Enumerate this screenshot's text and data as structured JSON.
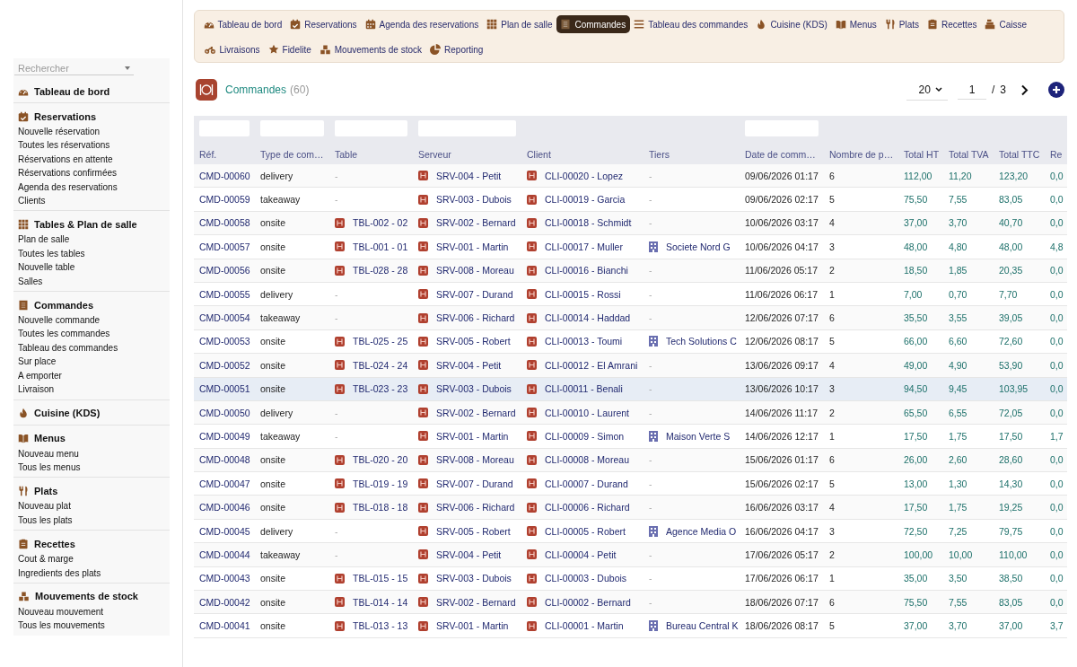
{
  "sidebar": {
    "search": {
      "placeholder": "Rechercher"
    },
    "sections": [
      {
        "title": "Tableau de bord"
      },
      {
        "title": "Reservations",
        "items": [
          "Nouvelle réservation",
          "Toutes les réservations",
          "Réservations en attente",
          "Réservations confirmées",
          "Agenda des reservations",
          "Clients"
        ]
      },
      {
        "title": "Tables & Plan de salle",
        "items": [
          "Plan de salle",
          "Toutes les tables",
          "Nouvelle table",
          "Salles"
        ]
      },
      {
        "title": "Commandes",
        "items": [
          "Nouvelle commande",
          "Toutes les commandes",
          "Tableau des commandes",
          "Sur place",
          "A emporter",
          "Livraison"
        ]
      },
      {
        "title": "Cuisine (KDS)"
      },
      {
        "title": "Menus",
        "items": [
          "Nouveau menu",
          "Tous les menus"
        ]
      },
      {
        "title": "Plats",
        "items": [
          "Nouveau plat",
          "Tous les plats"
        ]
      },
      {
        "title": "Recettes",
        "items": [
          "Cout & marge",
          "Ingredients des plats"
        ]
      },
      {
        "title": "Mouvements de stock",
        "items": [
          "Nouveau mouvement",
          "Tous les mouvements"
        ]
      }
    ]
  },
  "nav": {
    "tabs": [
      {
        "label": "Tableau de bord",
        "selected": false
      },
      {
        "label": "Reservations",
        "selected": false
      },
      {
        "label": "Agenda des reservations",
        "selected": false
      },
      {
        "label": "Plan de salle",
        "selected": false
      },
      {
        "label": "Commandes",
        "selected": true
      },
      {
        "label": "Tableau des commandes",
        "selected": false
      },
      {
        "label": "Cuisine (KDS)",
        "selected": false
      },
      {
        "label": "Menus",
        "selected": false
      },
      {
        "label": "Plats",
        "selected": false
      },
      {
        "label": "Recettes",
        "selected": false
      },
      {
        "label": "Caisse",
        "selected": false
      },
      {
        "label": "Livraisons",
        "selected": false
      },
      {
        "label": "Fidelite",
        "selected": false
      },
      {
        "label": "Mouvements de stock",
        "selected": false
      },
      {
        "label": "Reporting",
        "selected": false
      }
    ]
  },
  "list": {
    "title": "Commandes",
    "count": "(60)",
    "page_size": "20",
    "page": "1",
    "separator": "/",
    "pages": "3"
  },
  "table": {
    "columns": [
      {
        "label": "Réf.",
        "filter": true
      },
      {
        "label": "Type de com…",
        "filter": true
      },
      {
        "label": "Table",
        "filter": true
      },
      {
        "label": "Serveur",
        "filter": true
      },
      {
        "label": "Client",
        "filter": false
      },
      {
        "label": "Tiers",
        "filter": false
      },
      {
        "label": "Date de comm…",
        "filter": true
      },
      {
        "label": "Nombre de p…",
        "filter": false
      },
      {
        "label": "Total HT",
        "filter": false
      },
      {
        "label": "Total TVA",
        "filter": false
      },
      {
        "label": "Total TTC",
        "filter": false
      },
      {
        "label": "Re",
        "filter": false
      }
    ],
    "rows": [
      {
        "ref": "CMD-00060",
        "type": "delivery",
        "table": {
          "text": "-",
          "linked": false
        },
        "server": "SRV-004 - Petit",
        "client": "CLI-00020 - Lopez",
        "tiers": {
          "text": "-",
          "linked": false
        },
        "date": "09/06/2026 01:17",
        "covers": "6",
        "ht": "112,00",
        "tva": "11,20",
        "ttc": "123,20",
        "rem": "0,0",
        "selected": false
      },
      {
        "ref": "CMD-00059",
        "type": "takeaway",
        "table": {
          "text": "-",
          "linked": false
        },
        "server": "SRV-003 - Dubois",
        "client": "CLI-00019 - Garcia",
        "tiers": {
          "text": "-",
          "linked": false
        },
        "date": "09/06/2026 02:17",
        "covers": "5",
        "ht": "75,50",
        "tva": "7,55",
        "ttc": "83,05",
        "rem": "0,0",
        "selected": false
      },
      {
        "ref": "CMD-00058",
        "type": "onsite",
        "table": {
          "text": "TBL-002 - 02",
          "linked": true
        },
        "server": "SRV-002 - Bernard",
        "client": "CLI-00018 - Schmidt",
        "tiers": {
          "text": "-",
          "linked": false
        },
        "date": "10/06/2026 03:17",
        "covers": "4",
        "ht": "37,00",
        "tva": "3,70",
        "ttc": "40,70",
        "rem": "0,0",
        "selected": false
      },
      {
        "ref": "CMD-00057",
        "type": "onsite",
        "table": {
          "text": "TBL-001 - 01",
          "linked": true
        },
        "server": "SRV-001 - Martin",
        "client": "CLI-00017 - Muller",
        "tiers": {
          "text": "Societe Nord G",
          "linked": true
        },
        "date": "10/06/2026 04:17",
        "covers": "3",
        "ht": "48,00",
        "tva": "4,80",
        "ttc": "48,00",
        "rem": "4,8",
        "selected": false
      },
      {
        "ref": "CMD-00056",
        "type": "onsite",
        "table": {
          "text": "TBL-028 - 28",
          "linked": true
        },
        "server": "SRV-008 - Moreau",
        "client": "CLI-00016 - Bianchi",
        "tiers": {
          "text": "-",
          "linked": false
        },
        "date": "11/06/2026 05:17",
        "covers": "2",
        "ht": "18,50",
        "tva": "1,85",
        "ttc": "20,35",
        "rem": "0,0",
        "selected": false
      },
      {
        "ref": "CMD-00055",
        "type": "delivery",
        "table": {
          "text": "-",
          "linked": false
        },
        "server": "SRV-007 - Durand",
        "client": "CLI-00015 - Rossi",
        "tiers": {
          "text": "-",
          "linked": false
        },
        "date": "11/06/2026 06:17",
        "covers": "1",
        "ht": "7,00",
        "tva": "0,70",
        "ttc": "7,70",
        "rem": "0,0",
        "selected": false
      },
      {
        "ref": "CMD-00054",
        "type": "takeaway",
        "table": {
          "text": "-",
          "linked": false
        },
        "server": "SRV-006 - Richard",
        "client": "CLI-00014 - Haddad",
        "tiers": {
          "text": "-",
          "linked": false
        },
        "date": "12/06/2026 07:17",
        "covers": "6",
        "ht": "35,50",
        "tva": "3,55",
        "ttc": "39,05",
        "rem": "0,0",
        "selected": false
      },
      {
        "ref": "CMD-00053",
        "type": "onsite",
        "table": {
          "text": "TBL-025 - 25",
          "linked": true
        },
        "server": "SRV-005 - Robert",
        "client": "CLI-00013 - Toumi",
        "tiers": {
          "text": "Tech Solutions C",
          "linked": true
        },
        "date": "12/06/2026 08:17",
        "covers": "5",
        "ht": "66,00",
        "tva": "6,60",
        "ttc": "72,60",
        "rem": "0,0",
        "selected": false
      },
      {
        "ref": "CMD-00052",
        "type": "onsite",
        "table": {
          "text": "TBL-024 - 24",
          "linked": true
        },
        "server": "SRV-004 - Petit",
        "client": "CLI-00012 - El Amrani",
        "tiers": {
          "text": "-",
          "linked": false
        },
        "date": "13/06/2026 09:17",
        "covers": "4",
        "ht": "49,00",
        "tva": "4,90",
        "ttc": "53,90",
        "rem": "0,0",
        "selected": false
      },
      {
        "ref": "CMD-00051",
        "type": "onsite",
        "table": {
          "text": "TBL-023 - 23",
          "linked": true
        },
        "server": "SRV-003 - Dubois",
        "client": "CLI-00011 - Benali",
        "tiers": {
          "text": "-",
          "linked": false
        },
        "date": "13/06/2026 10:17",
        "covers": "3",
        "ht": "94,50",
        "tva": "9,45",
        "ttc": "103,95",
        "rem": "0,0",
        "selected": true
      },
      {
        "ref": "CMD-00050",
        "type": "delivery",
        "table": {
          "text": "-",
          "linked": false
        },
        "server": "SRV-002 - Bernard",
        "client": "CLI-00010 - Laurent",
        "tiers": {
          "text": "-",
          "linked": false
        },
        "date": "14/06/2026 11:17",
        "covers": "2",
        "ht": "65,50",
        "tva": "6,55",
        "ttc": "72,05",
        "rem": "0,0",
        "selected": false
      },
      {
        "ref": "CMD-00049",
        "type": "takeaway",
        "table": {
          "text": "-",
          "linked": false
        },
        "server": "SRV-001 - Martin",
        "client": "CLI-00009 - Simon",
        "tiers": {
          "text": "Maison Verte S",
          "linked": true
        },
        "date": "14/06/2026 12:17",
        "covers": "1",
        "ht": "17,50",
        "tva": "1,75",
        "ttc": "17,50",
        "rem": "1,7",
        "selected": false
      },
      {
        "ref": "CMD-00048",
        "type": "onsite",
        "table": {
          "text": "TBL-020 - 20",
          "linked": true
        },
        "server": "SRV-008 - Moreau",
        "client": "CLI-00008 - Moreau",
        "tiers": {
          "text": "-",
          "linked": false
        },
        "date": "15/06/2026 01:17",
        "covers": "6",
        "ht": "26,00",
        "tva": "2,60",
        "ttc": "28,60",
        "rem": "0,0",
        "selected": false
      },
      {
        "ref": "CMD-00047",
        "type": "onsite",
        "table": {
          "text": "TBL-019 - 19",
          "linked": true
        },
        "server": "SRV-007 - Durand",
        "client": "CLI-00007 - Durand",
        "tiers": {
          "text": "-",
          "linked": false
        },
        "date": "15/06/2026 02:17",
        "covers": "5",
        "ht": "13,00",
        "tva": "1,30",
        "ttc": "14,30",
        "rem": "0,0",
        "selected": false
      },
      {
        "ref": "CMD-00046",
        "type": "onsite",
        "table": {
          "text": "TBL-018 - 18",
          "linked": true
        },
        "server": "SRV-006 - Richard",
        "client": "CLI-00006 - Richard",
        "tiers": {
          "text": "-",
          "linked": false
        },
        "date": "16/06/2026 03:17",
        "covers": "4",
        "ht": "17,50",
        "tva": "1,75",
        "ttc": "19,25",
        "rem": "0,0",
        "selected": false
      },
      {
        "ref": "CMD-00045",
        "type": "delivery",
        "table": {
          "text": "-",
          "linked": false
        },
        "server": "SRV-005 - Robert",
        "client": "CLI-00005 - Robert",
        "tiers": {
          "text": "Agence Media O",
          "linked": true
        },
        "date": "16/06/2026 04:17",
        "covers": "3",
        "ht": "72,50",
        "tva": "7,25",
        "ttc": "79,75",
        "rem": "0,0",
        "selected": false
      },
      {
        "ref": "CMD-00044",
        "type": "takeaway",
        "table": {
          "text": "-",
          "linked": false
        },
        "server": "SRV-004 - Petit",
        "client": "CLI-00004 - Petit",
        "tiers": {
          "text": "-",
          "linked": false
        },
        "date": "17/06/2026 05:17",
        "covers": "2",
        "ht": "100,00",
        "tva": "10,00",
        "ttc": "110,00",
        "rem": "0,0",
        "selected": false
      },
      {
        "ref": "CMD-00043",
        "type": "onsite",
        "table": {
          "text": "TBL-015 - 15",
          "linked": true
        },
        "server": "SRV-003 - Dubois",
        "client": "CLI-00003 - Dubois",
        "tiers": {
          "text": "-",
          "linked": false
        },
        "date": "17/06/2026 06:17",
        "covers": "1",
        "ht": "35,00",
        "tva": "3,50",
        "ttc": "38,50",
        "rem": "0,0",
        "selected": false
      },
      {
        "ref": "CMD-00042",
        "type": "onsite",
        "table": {
          "text": "TBL-014 - 14",
          "linked": true
        },
        "server": "SRV-002 - Bernard",
        "client": "CLI-00002 - Bernard",
        "tiers": {
          "text": "-",
          "linked": false
        },
        "date": "18/06/2026 07:17",
        "covers": "6",
        "ht": "75,50",
        "tva": "7,55",
        "ttc": "83,05",
        "rem": "0,0",
        "selected": false
      },
      {
        "ref": "CMD-00041",
        "type": "onsite",
        "table": {
          "text": "TBL-013 - 13",
          "linked": true
        },
        "server": "SRV-001 - Martin",
        "client": "CLI-00001 - Martin",
        "tiers": {
          "text": "Bureau Central K",
          "linked": true
        },
        "date": "18/06/2026 08:17",
        "covers": "5",
        "ht": "37,00",
        "tva": "3,70",
        "ttc": "37,00",
        "rem": "3,7",
        "selected": false
      }
    ]
  }
}
